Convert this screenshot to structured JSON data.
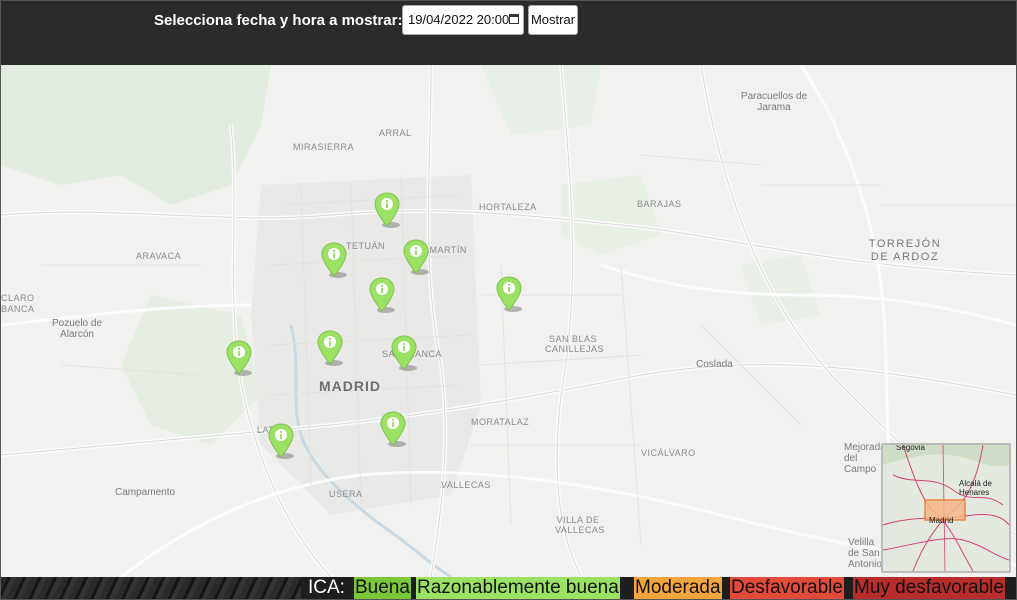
{
  "header": {
    "prompt": "Selecciona fecha y hora a mostrar:",
    "datetime_value": "19/04/2022 20:00",
    "show_button": "Mostrar",
    "calendar_icon": "calendar-icon"
  },
  "map": {
    "places": {
      "arral": "ARRAL",
      "mirasierra": "MIRASIERRA",
      "paracuellos": "Paracuellos de Jarama",
      "hortaleza": "HORTALEZA",
      "barajas": "BARAJAS",
      "tetuan": "TETUÁN",
      "chamartin": "CHAMARTÍN",
      "aravaca": "ARAVACA",
      "torrejon": "TORREJÓN DE ARDOZ",
      "claro_banca": "CLARO BANCA",
      "pozuelo": "Pozuelo de Alarcón",
      "san_blas": "SAN BLAS CANILLEJAS",
      "salamanca": "SALAMANCA",
      "madrid": "MADRID",
      "coslada": "Coslada",
      "latina": "LATINA",
      "moratalaz": "MORATALAZ",
      "vicalvaro": "VICÁLVARO",
      "mejorada": "Mejorada del Campo",
      "campamento": "Campamento",
      "usera": "USERA",
      "vallecas": "VALLECAS",
      "villa_vallecas": "VILLA DE VALLECAS",
      "velilla": "Velilla de San Antonio"
    },
    "marker_color": "#9be264",
    "marker_icon": "info-icon",
    "minimap": {
      "segovia": "Segovia",
      "alcala": "Alcalá de Henares",
      "madrid": "Madrid"
    }
  },
  "legend": {
    "label": "ICA:",
    "categories": [
      {
        "label": "Buena",
        "color": "#7cc63a"
      },
      {
        "label": "Razonablemente buena",
        "color": "#9be264"
      },
      {
        "label": "Moderada",
        "color": "#f4a63d"
      },
      {
        "label": "Desfavorable",
        "color": "#e24b3b"
      },
      {
        "label": "Muy desfavorable",
        "color": "#b82c2c"
      }
    ]
  }
}
